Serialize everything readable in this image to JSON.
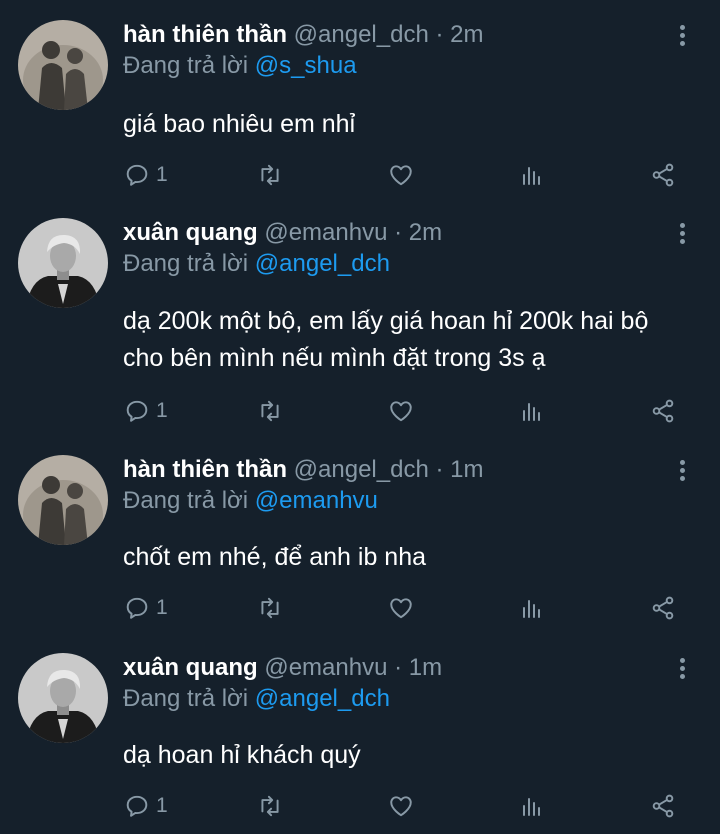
{
  "colors": {
    "background": "#15202b",
    "secondary": "#8899a6",
    "mention": "#1d9bf0",
    "text": "#ffffff"
  },
  "icons": [
    "reply-icon",
    "retweet-icon",
    "like-icon",
    "analytics-icon",
    "share-icon",
    "more-icon"
  ],
  "tweets": [
    {
      "name": "hàn thiên thần",
      "handle": "@angel_dch",
      "dot": "·",
      "time": "2m",
      "reply_prefix": "Đang trả lời",
      "reply_to": "@s_shua",
      "lines": [
        "giá bao nhiêu em nhỉ"
      ],
      "reply_count": "1"
    },
    {
      "name": "xuân quang",
      "handle": "@emanhvu",
      "dot": "·",
      "time": "2m",
      "reply_prefix": "Đang trả lời",
      "reply_to": "@angel_dch",
      "lines": [
        "dạ 200k một bộ, em lấy giá hoan hỉ 200k hai bộ",
        "cho bên mình nếu mình đặt trong 3s ạ"
      ],
      "reply_count": "1"
    },
    {
      "name": "hàn thiên thần",
      "handle": "@angel_dch",
      "dot": "·",
      "time": "1m",
      "reply_prefix": "Đang trả lời",
      "reply_to": "@emanhvu",
      "lines": [
        "chốt em nhé, để anh ib nha"
      ],
      "reply_count": "1"
    },
    {
      "name": "xuân quang",
      "handle": "@emanhvu",
      "dot": "·",
      "time": "1m",
      "reply_prefix": "Đang trả lời",
      "reply_to": "@angel_dch",
      "lines": [
        "dạ hoan hỉ khách quý"
      ],
      "reply_count": "1"
    }
  ]
}
